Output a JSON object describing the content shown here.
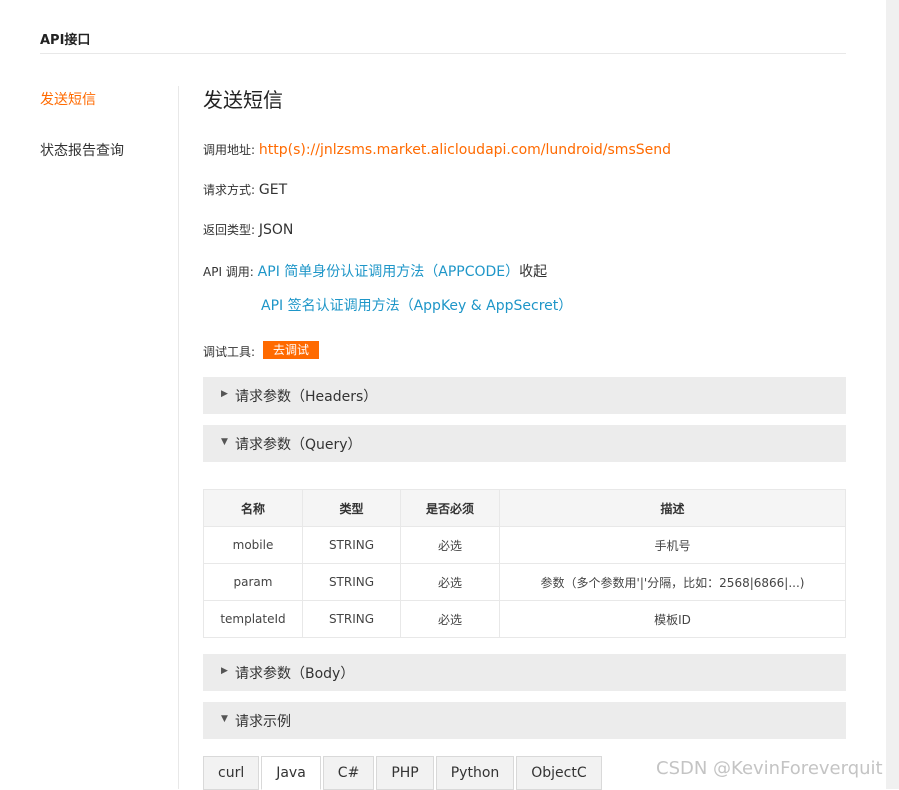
{
  "header": {
    "title": "API接口"
  },
  "sidebar": {
    "items": [
      {
        "label": "发送短信",
        "active": true
      },
      {
        "label": "状态报告查询",
        "active": false
      }
    ]
  },
  "main": {
    "title": "发送短信",
    "call_address": {
      "label": "调用地址:",
      "value": "http(s)://jnlzsms.market.alicloudapi.com/lundroid/smsSend"
    },
    "request_method": {
      "label": "请求方式:",
      "value": "GET"
    },
    "return_type": {
      "label": "返回类型:",
      "value": "JSON"
    },
    "api_call": {
      "label": "API 调用:",
      "appcode_link": "API 简单身份认证调用方法（APPCODE）",
      "collapse": "收起",
      "signature_link": "API 签名认证调用方法（AppKey & AppSecret）"
    },
    "debug_tool": {
      "label": "调试工具:",
      "button": "去调试"
    },
    "sections": {
      "headers": "请求参数（Headers）",
      "query": "请求参数（Query）",
      "body": "请求参数（Body）",
      "example": "请求示例"
    },
    "query_table": {
      "columns": [
        "名称",
        "类型",
        "是否必须",
        "描述"
      ],
      "rows": [
        {
          "name": "mobile",
          "type": "STRING",
          "required": "必选",
          "desc": "手机号"
        },
        {
          "name": "param",
          "type": "STRING",
          "required": "必选",
          "desc": "参数（多个参数用'|'分隔，比如：2568|6866|...)"
        },
        {
          "name": "templateId",
          "type": "STRING",
          "required": "必选",
          "desc": "模板ID"
        }
      ]
    },
    "example_tabs": [
      {
        "label": "curl",
        "active": false
      },
      {
        "label": "Java",
        "active": true
      },
      {
        "label": "C#",
        "active": false
      },
      {
        "label": "PHP",
        "active": false
      },
      {
        "label": "Python",
        "active": false
      },
      {
        "label": "ObjectC",
        "active": false
      }
    ]
  },
  "watermark": "CSDN @KevinForeverquit",
  "colors": {
    "accent": "#ff6a00",
    "link": "#1e96c8",
    "section_bg": "#ececec"
  },
  "icons": {
    "collapsed_caret": "caret-right-icon",
    "expanded_caret": "caret-down-icon"
  }
}
